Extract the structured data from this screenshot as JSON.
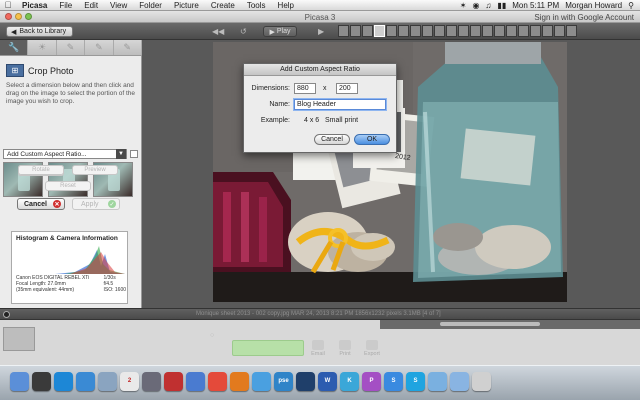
{
  "menubar": {
    "app_name": "Picasa",
    "items": [
      "File",
      "Edit",
      "View",
      "Folder",
      "Picture",
      "Create",
      "Tools",
      "Help"
    ],
    "clock": "Mon 5:11 PM",
    "user": "Morgan Howard"
  },
  "window": {
    "title": "Picasa 3",
    "signin": "Sign in with Google Account"
  },
  "toolbar": {
    "back_label": "Back to Library",
    "play_label": "Play"
  },
  "left_panel": {
    "title": "Crop Photo",
    "description": "Select a dimension below and then click and drag on the image to select the portion of the image you wish to crop.",
    "ratio_value": "Add Custom Aspect Ratio...",
    "rotate_label": "Rotate",
    "preview_label": "Preview",
    "reset_label": "Reset",
    "cancel_label": "Cancel",
    "apply_label": "Apply"
  },
  "histogram": {
    "title": "Histogram & Camera Information",
    "camera": "Canon EOS DIGITAL REBEL XTi",
    "focal": "Focal Length: 27.0mm",
    "equiv": "(35mm equivalent: 44mm)",
    "shutter": "1/30s",
    "aperture": "f/4.5",
    "iso": "ISO: 1600"
  },
  "dialog": {
    "title": "Add Custom Aspect Ratio",
    "dimensions_label": "Dimensions:",
    "width_value": "880",
    "x_label": "x",
    "height_value": "200",
    "name_label": "Name:",
    "name_value": "Blog Header",
    "example_label": "Example:",
    "example_value": "4 x 6   Small print",
    "cancel_label": "Cancel",
    "ok_label": "OK"
  },
  "photo": {
    "jar_label": "2012"
  },
  "statusbar": {
    "info": "Monique sheet 2013 - 002 copy.jpg    MAR 24, 2013 8:21 PM    1856x1232 pixels    3.1MB    [4 of 7]"
  },
  "tray": {
    "hold_label": "Hold",
    "actions": [
      "Email",
      "Print",
      "Export"
    ],
    "caption": "[Morgan Howard]"
  },
  "dock": {
    "icons": [
      "finder-icon",
      "dashboard-icon",
      "appstore-icon",
      "safari-icon",
      "mail-icon",
      "calendar-icon",
      "launchpad-icon",
      "photobooth-icon",
      "picasa-icon",
      "chrome-icon",
      "firefox-icon",
      "itunes-icon",
      "pse-icon",
      "ps-icon",
      "word-icon",
      "k-icon",
      "p-icon",
      "s-icon",
      "skype-icon",
      "folder-icon",
      "folder2-icon",
      "trash-icon"
    ],
    "labels": [
      "",
      "",
      "",
      "",
      "",
      "2",
      "",
      "",
      "",
      "",
      "",
      "",
      "psе",
      "",
      "W",
      "K",
      "P",
      "S",
      "S",
      "",
      "",
      ""
    ]
  },
  "colors": {
    "accent": "#4a8ee0",
    "cancel_red": "#d02f2f",
    "apply_green": "#9fd69f"
  }
}
